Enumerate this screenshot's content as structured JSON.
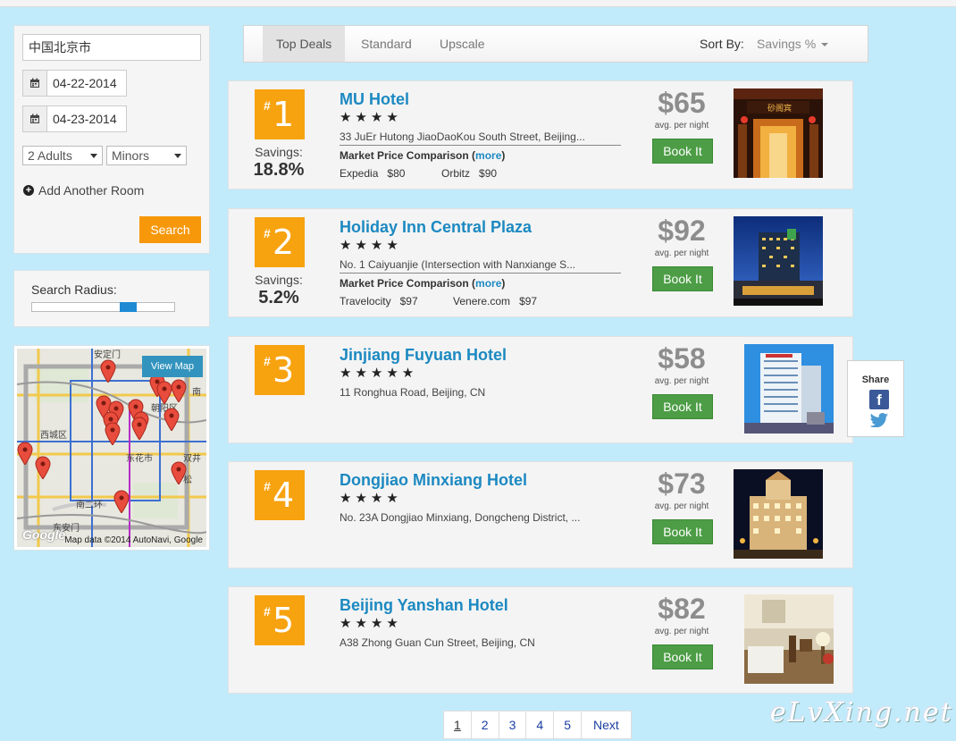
{
  "search": {
    "destination": "中国北京市",
    "checkin": "04-22-2014",
    "checkout": "04-23-2014",
    "adults": "2 Adults",
    "minors": "Minors",
    "add_room": "Add Another Room",
    "search_button": "Search"
  },
  "radius": {
    "label": "Search Radius:",
    "level": 0.7
  },
  "map": {
    "view_map": "View Map",
    "credit": "Map data ©2014 AutoNavi, Google",
    "google": "Google"
  },
  "sort_bar": {
    "tabs": [
      "Top Deals",
      "Standard",
      "Upscale"
    ],
    "active_tab": "Top Deals",
    "sort_label": "Sort By:",
    "sort_value": "Savings %"
  },
  "hotels": [
    {
      "rank": "1",
      "savings_label": "Savings:",
      "savings": "18.8%",
      "name": "MU Hotel",
      "stars": "★★★★",
      "address": "33 JuEr Hutong JiaoDaoKou South Street, Beijing...",
      "market_label": "Market Price Comparison (",
      "more": "more",
      "comparisons": [
        {
          "site": "Expedia",
          "price": "$80"
        },
        {
          "site": "Orbitz",
          "price": "$90"
        }
      ],
      "price": "$65",
      "per_night": "avg. per night",
      "book": "Book It"
    },
    {
      "rank": "2",
      "savings_label": "Savings:",
      "savings": "5.2%",
      "name": "Holiday Inn Central Plaza",
      "stars": "★★★★",
      "address": "No. 1 Caiyuanjie (Intersection with Nanxiange S...",
      "market_label": "Market Price Comparison (",
      "more": "more",
      "comparisons": [
        {
          "site": "Travelocity",
          "price": "$97"
        },
        {
          "site": "Venere.com",
          "price": "$97"
        }
      ],
      "price": "$92",
      "per_night": "avg. per night",
      "book": "Book It"
    },
    {
      "rank": "3",
      "name": "Jinjiang Fuyuan Hotel",
      "stars": "★★★★★",
      "address": "11 Ronghua Road, Beijing, CN",
      "price": "$58",
      "per_night": "avg. per night",
      "book": "Book It"
    },
    {
      "rank": "4",
      "name": "Dongjiao Minxiang Hotel",
      "stars": "★★★★",
      "address": "No. 23A Dongjiao Minxiang, Dongcheng District, ...",
      "price": "$73",
      "per_night": "avg. per night",
      "book": "Book It"
    },
    {
      "rank": "5",
      "name": "Beijing Yanshan Hotel",
      "stars": "★★★★",
      "address": "A38 Zhong Guan Cun Street, Beijing, CN",
      "price": "$82",
      "per_night": "avg. per night",
      "book": "Book It"
    }
  ],
  "share": {
    "label": "Share"
  },
  "pagination": {
    "pages": [
      "1",
      "2",
      "3",
      "4",
      "5"
    ],
    "current": "1",
    "next": "Next"
  },
  "watermark": "eLvXing.net",
  "colors": {
    "accent_orange": "#f7a20f",
    "link_blue": "#1c89c1",
    "book_green": "#4c9d45",
    "background": "#c1ebfb"
  }
}
